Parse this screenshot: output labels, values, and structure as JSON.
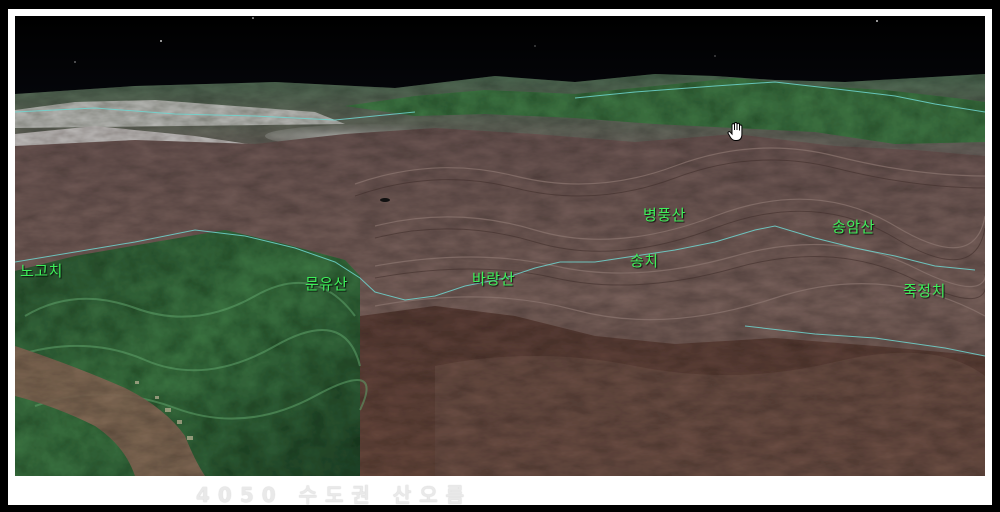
{
  "places": {
    "nogochi": "노고치",
    "munyusan": "문유산",
    "baraksan": "바랑산",
    "songchi": "송치",
    "byeongpungsan": "병풍산",
    "songamsan": "송암산",
    "jukjeongchi": "죽정치"
  },
  "watermark": "4050 수도권 산오름",
  "colors": {
    "label": "#3ef05a",
    "ridge_line": "#6fd6d0",
    "border": "#ffffff"
  }
}
